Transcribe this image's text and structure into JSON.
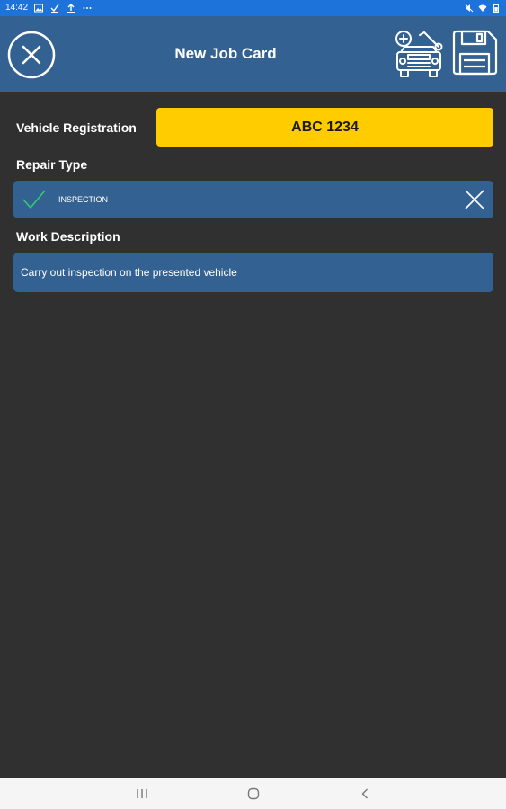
{
  "status_bar": {
    "time": "14:42",
    "left_icons": [
      "image-icon",
      "check-icon",
      "upload-icon",
      "more-icon"
    ],
    "right_icons": [
      "mute-icon",
      "wifi-icon",
      "battery-icon"
    ]
  },
  "header": {
    "title": "New Job Card",
    "close_icon": "close-icon",
    "vehicle_icon": "vehicle-add-icon",
    "save_icon": "save-icon"
  },
  "form": {
    "vehicle_registration": {
      "label": "Vehicle Registration",
      "value": "ABC 1234"
    },
    "repair_type": {
      "label": "Repair Type",
      "value": "INSPECTION"
    },
    "work_description": {
      "label": "Work Description",
      "value": "Carry out inspection on the presented vehicle"
    }
  },
  "colors": {
    "status_bar": "#1d73d9",
    "app_bar": "#336292",
    "background": "#303030",
    "registration_field": "#ffcc00",
    "check": "#2ecc71"
  },
  "nav_bar": {
    "icons": [
      "recents-icon",
      "home-icon",
      "back-icon"
    ]
  }
}
